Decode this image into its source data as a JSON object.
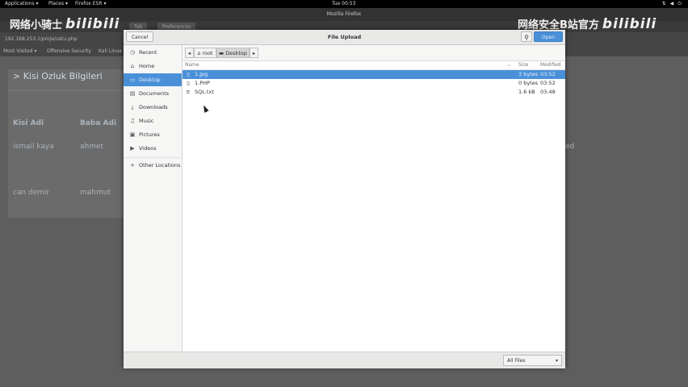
{
  "topbar": {
    "applications": "Applications ▾",
    "places": "Places ▾",
    "app": "Firefox ESR ▾",
    "clock": "Tue 00:53"
  },
  "firefox": {
    "window_title": "Mozilla Firefox",
    "tabs": [
      "Tab",
      "Preferences"
    ],
    "url": "192.168.253.1/proje/ustu.php",
    "bookmarks": [
      "Most Visited ▾",
      "Offensive Security",
      "Kali Linux"
    ],
    "page": {
      "heading": "> Kisi Ozluk Bilgileri",
      "col1": "Kisi Adi",
      "col2": "Baba Adi",
      "rows": [
        {
          "name": "ismail kaya",
          "father": "ahmet"
        },
        {
          "name": "can demir",
          "father": "mahmut"
        }
      ],
      "right_fragment": "ed"
    }
  },
  "watermark": {
    "left": "网络小骑士",
    "right": "网络安全B站官方",
    "logo": "bilibili"
  },
  "dialog": {
    "title": "File Upload",
    "cancel": "Cancel",
    "open": "Open",
    "sidebar": [
      {
        "icon": "clock-icon",
        "glyph": "◷",
        "label": "Recent"
      },
      {
        "icon": "home-icon",
        "glyph": "⌂",
        "label": "Home"
      },
      {
        "icon": "desktop-icon",
        "glyph": "▭",
        "label": "Desktop"
      },
      {
        "icon": "documents-icon",
        "glyph": "▤",
        "label": "Documents"
      },
      {
        "icon": "downloads-icon",
        "glyph": "⤓",
        "label": "Downloads"
      },
      {
        "icon": "music-icon",
        "glyph": "♫",
        "label": "Music"
      },
      {
        "icon": "pictures-icon",
        "glyph": "▣",
        "label": "Pictures"
      },
      {
        "icon": "videos-icon",
        "glyph": "▶",
        "label": "Videos"
      },
      {
        "icon": "plus-icon",
        "glyph": "+",
        "label": "Other Locations"
      }
    ],
    "path": {
      "back": "◂",
      "root": "root",
      "current": "Desktop",
      "forward": "▸"
    },
    "columns": {
      "name": "Name",
      "size": "Size",
      "modified": "Modified"
    },
    "files": [
      {
        "icon": "file-icon",
        "name": "1.jpg",
        "size": "3 bytes",
        "modified": "03:52"
      },
      {
        "icon": "file-icon",
        "name": "1.PHP",
        "size": "0 bytes",
        "modified": "03:52"
      },
      {
        "icon": "text-file-icon",
        "name": "SQL.txt",
        "size": "1.6 kB",
        "modified": "03:48"
      }
    ],
    "filter": "All Files"
  }
}
